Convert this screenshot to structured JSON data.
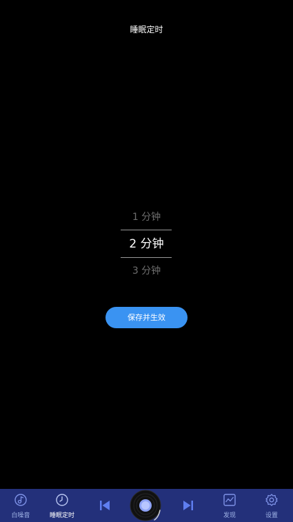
{
  "header": {
    "title": "睡眠定时"
  },
  "picker": {
    "prev": "1 分钟",
    "current": "2 分钟",
    "next": "3 分钟"
  },
  "actions": {
    "save_label": "保存并生效"
  },
  "tabbar": {
    "items": [
      {
        "label": "白噪音",
        "icon": "music-note-icon"
      },
      {
        "label": "睡眠定时",
        "icon": "clock-icon"
      },
      {
        "label": "发现",
        "icon": "chart-icon"
      },
      {
        "label": "设置",
        "icon": "gear-icon"
      }
    ],
    "controls": [
      "previous-track-icon",
      "vinyl-disc-icon",
      "next-track-icon"
    ],
    "active_index": 1
  },
  "colors": {
    "background": "#000000",
    "accent": "#3a93f2",
    "tabbar": "#23307a",
    "tab_icon": "#7f93e8"
  }
}
